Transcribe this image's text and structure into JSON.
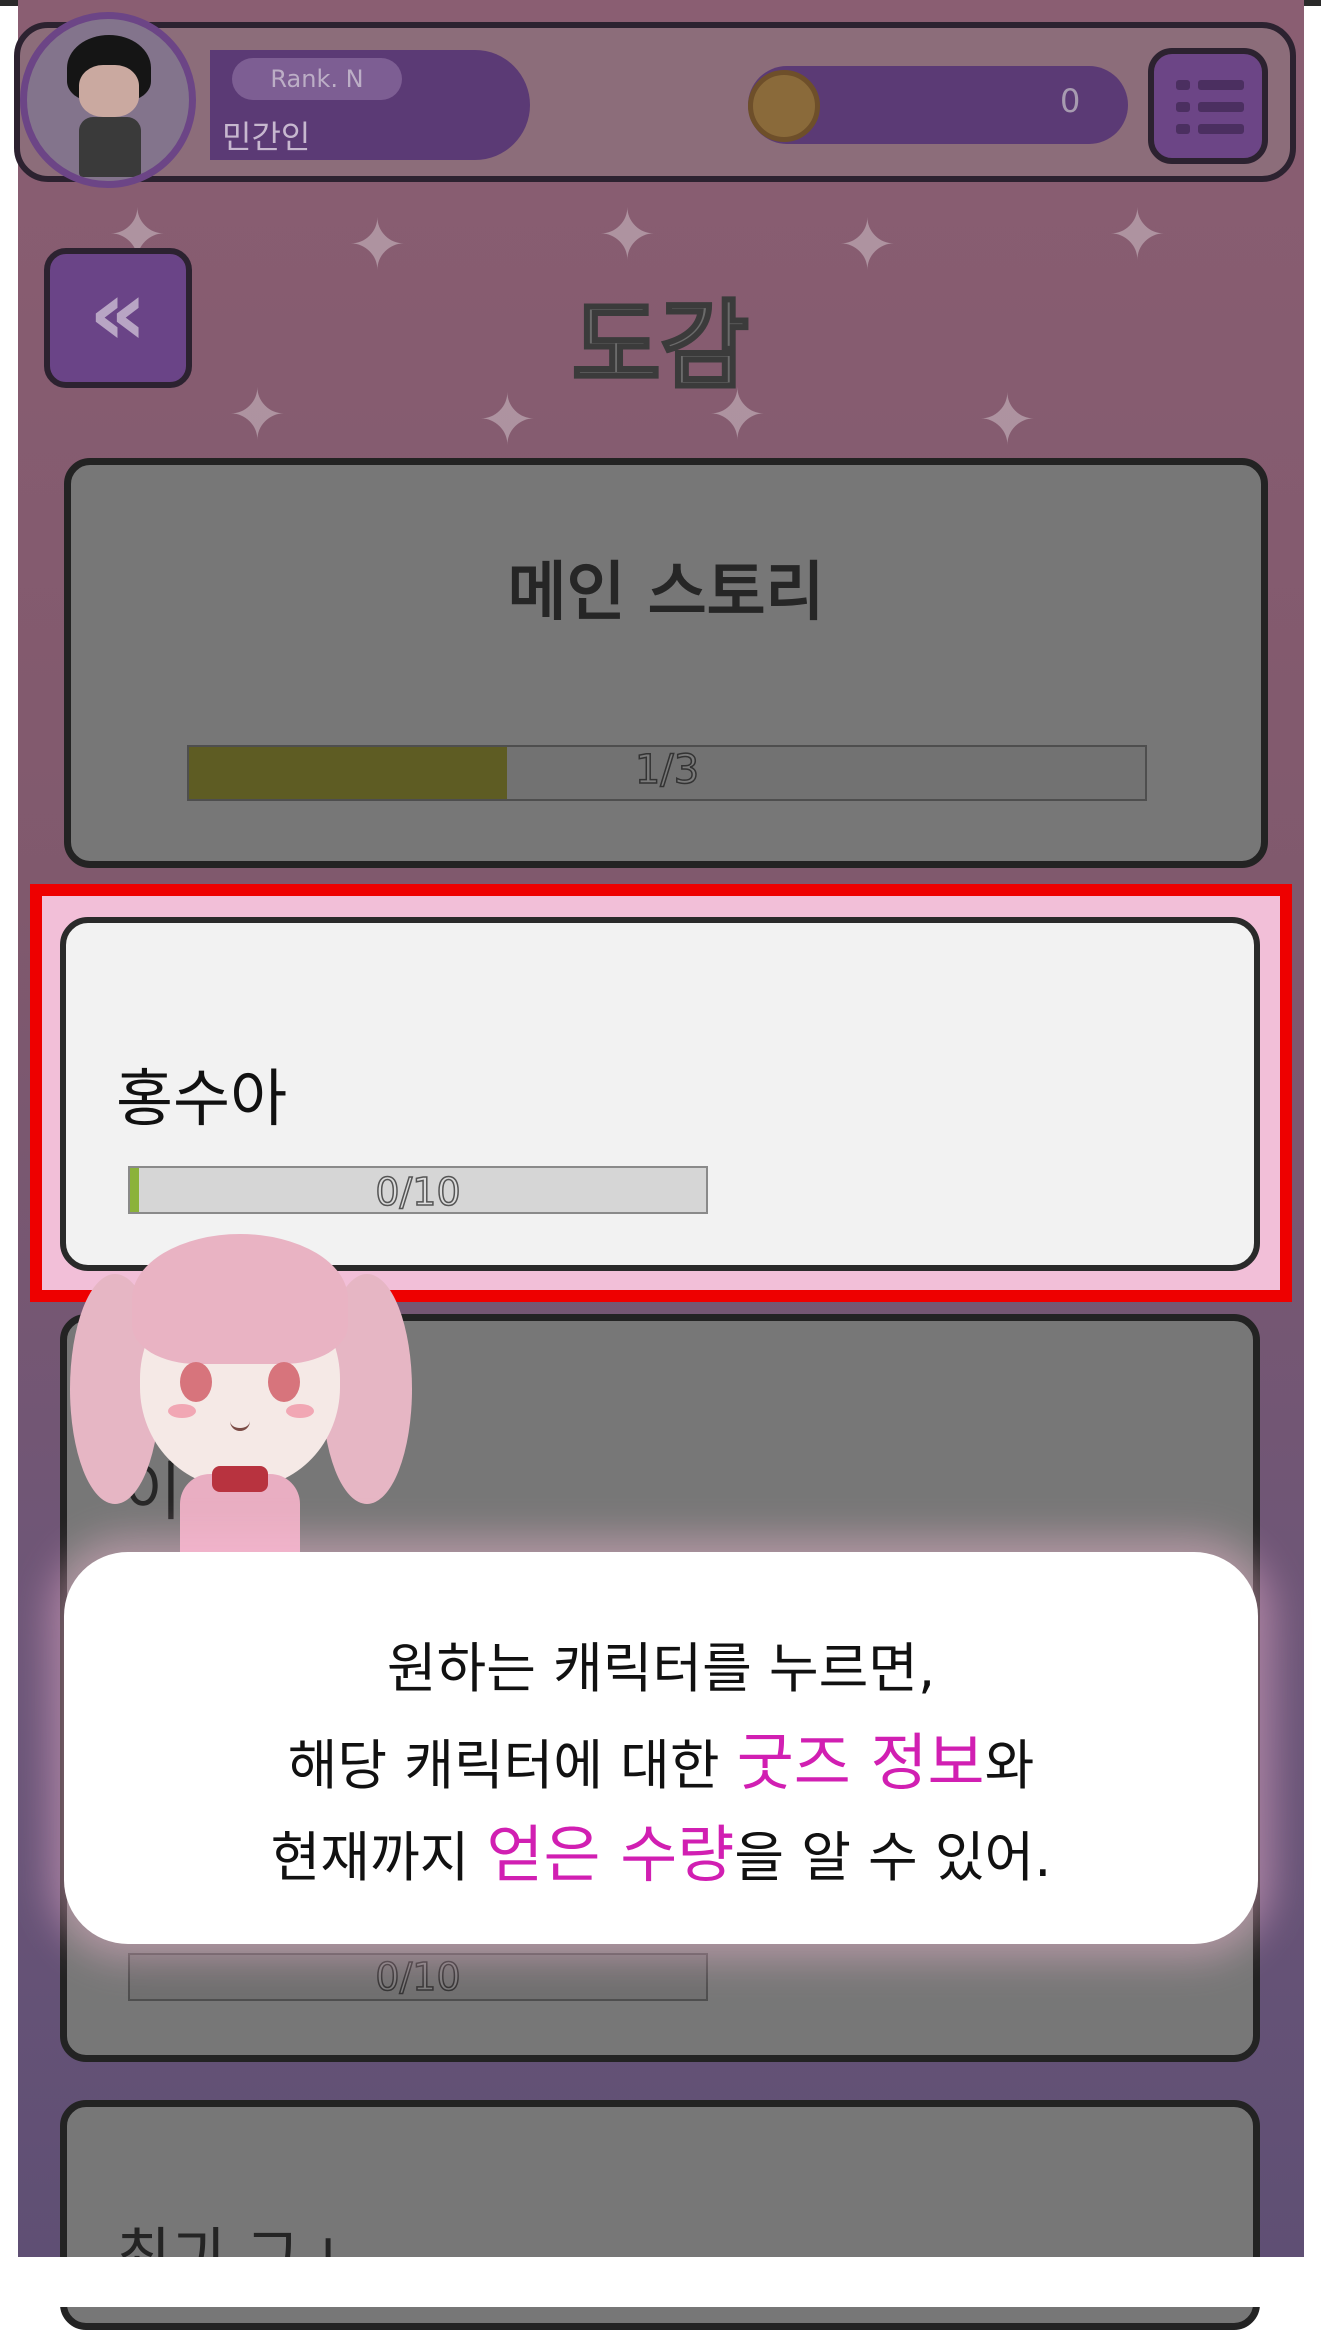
{
  "header": {
    "rank": "Rank. N",
    "username": "민간인",
    "coins": "0"
  },
  "page": {
    "title": "도감"
  },
  "cards": {
    "main_story": {
      "title": "메인 스토리",
      "progress_text": "1/3",
      "progress": 0.333
    },
    "selected": {
      "title": "홍수아",
      "progress_text": "0/10",
      "progress": 0.0
    },
    "third": {
      "title_partial": "이",
      "progress_text": "0/10"
    },
    "bottom": {
      "title_partial": "최긔 그ㅗ"
    }
  },
  "dialog": {
    "line1": "원하는 캐릭터를 누르면,",
    "line2_a": "해당 캐릭터에 대한 ",
    "line2_hl": "굿즈 정보",
    "line2_b": "와",
    "line3_a": "현재까지 ",
    "line3_hl": "얻은 수량",
    "line3_b": "을 알 수 있어."
  },
  "colors": {
    "highlight_frame": "#ee0000",
    "dialog_highlight_text": "#d11fb2",
    "progress_fill": "#8bb23a"
  }
}
